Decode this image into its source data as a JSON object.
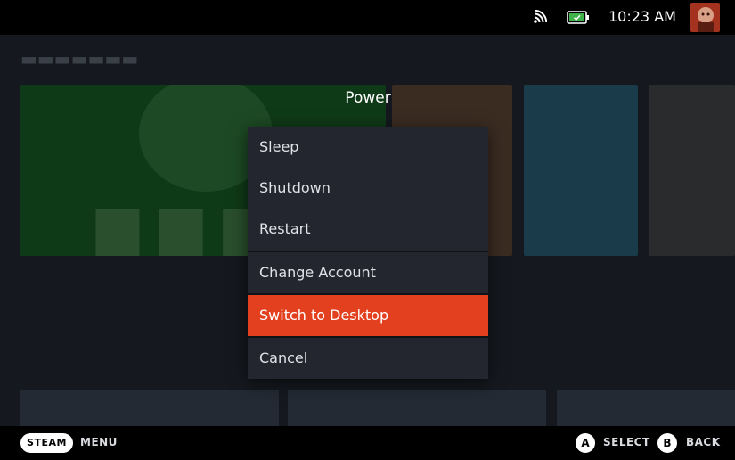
{
  "status_bar": {
    "time": "10:23 AM",
    "icons": [
      "wifi-icon",
      "battery-icon"
    ],
    "avatar": "user-avatar"
  },
  "power_menu": {
    "title": "Power",
    "items": [
      {
        "label": "Sleep"
      },
      {
        "label": "Shutdown"
      },
      {
        "label": "Restart"
      },
      {
        "label": "Change Account"
      },
      {
        "label": "Switch to Desktop",
        "selected": true
      },
      {
        "label": "Cancel"
      }
    ],
    "accent": "#e2401f"
  },
  "bottom_bar": {
    "steam_label": "STEAM",
    "menu_label": "MENU",
    "a_glyph": "A",
    "select_label": "SELECT",
    "b_glyph": "B",
    "back_label": "BACK"
  }
}
